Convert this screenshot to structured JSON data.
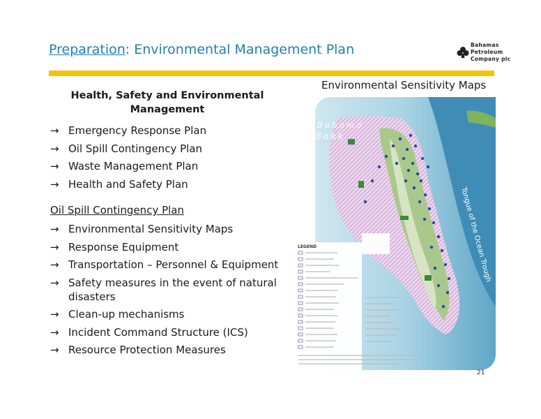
{
  "header": {
    "title_link": "Preparation",
    "title_rest": ": Environmental Management Plan",
    "logo_lines": [
      "Bahamas",
      "Petroleum",
      "Company plc"
    ]
  },
  "hse": {
    "heading": "Health, Safety and Environmental Management",
    "items": [
      "Emergency Response Plan",
      "Oil Spill Contingency Plan",
      "Waste Management Plan",
      "Health and Safety Plan"
    ]
  },
  "oil_spill": {
    "heading": "Oil Spill Contingency Plan",
    "items": [
      "Environmental Sensitivity Maps",
      "Response Equipment",
      "Transportation – Personnel & Equipment",
      "Safety measures in the event of natural disasters",
      "Clean-up mechanisms",
      "Incident Command Structure (ICS)",
      "Resource Protection Measures"
    ]
  },
  "map": {
    "title": "Environmental Sensitivity Maps",
    "labels": [
      "Bahama",
      "Bank",
      "Tongue of the Ocean Trough",
      "LEGEND"
    ]
  },
  "arrow": "→",
  "colors": {
    "accent_blue": "#1f7fb6",
    "rule_yellow": "#f5c400"
  },
  "page_number": "21"
}
